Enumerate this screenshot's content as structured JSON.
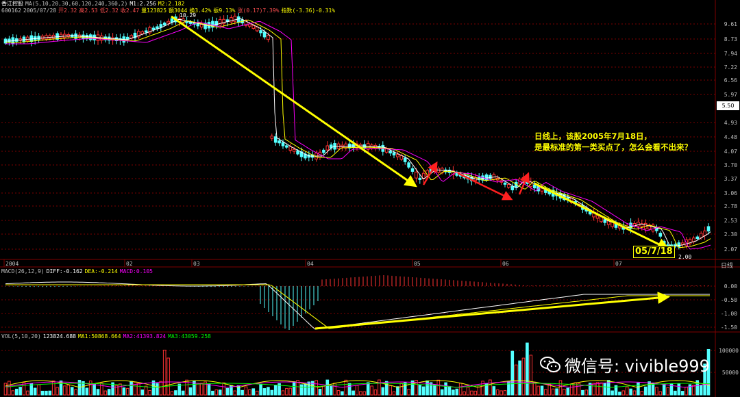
{
  "header": {
    "name": "香江控股",
    "ma_label": "MA(5,10,20,30,60,120,240,360,2)",
    "m1": "M1:2.256",
    "m2": "M2:2.182",
    "code": "600162",
    "date": "2005/07/28",
    "open": "开2.32",
    "high": "高2.53",
    "low": "低2.32",
    "close": "收2.47",
    "volume": "量123825",
    "amount": "额3044",
    "turnover": "换3.42%",
    "amplitude": "振9.13%",
    "change": "涨(0.17)7.39%",
    "index": "指数(-3.36)-0.31%"
  },
  "price_badge": "5.50",
  "annotation": {
    "line1": "日线上，该股2005年7月18日，",
    "line2": "是最标准的第一类买点了，怎么会看不出来？"
  },
  "date_marker": "05/7/18",
  "day_label": "日线",
  "macd_header": {
    "label": "MACD(26,12,9)",
    "diff": "DIFF:-0.162",
    "dea": "DEA:-0.214",
    "macd": "MACD:0.105"
  },
  "vol_header": {
    "label": "VOL(5,10,20)",
    "value": "123824.688",
    "ma1": "MA1:50868.664",
    "ma2": "MA2:41393.824",
    "ma3": "MA3:43059.258"
  },
  "watermark": "微信号: vivible999",
  "chart_data": {
    "type": "candlestick",
    "price_axis_ticks": [
      "9.61",
      "8.73",
      "7.94",
      "7.22",
      "6.56",
      "5.97",
      "4.93",
      "4.48",
      "4.07",
      "3.70",
      "3.37",
      "3.06",
      "2.78",
      "2.53",
      "2.30",
      "2.07"
    ],
    "time_axis_ticks": [
      "2004",
      "02",
      "03",
      "04",
      "05",
      "06",
      "07"
    ],
    "annotations": [
      "10.29",
      "2.00"
    ],
    "macd_axis_ticks": [
      "0.00",
      "-0.50",
      "-1.00",
      "-1.50"
    ],
    "vol_axis_ticks": [
      "100000",
      "50000"
    ],
    "colors": {
      "up": "#ff3232",
      "down": "#54ffff",
      "ma5": "#ffffff",
      "ma10": "#ffff00",
      "arrow_yellow": "#ffff00",
      "arrow_red": "#ff2020",
      "grid": "#800000"
    }
  }
}
